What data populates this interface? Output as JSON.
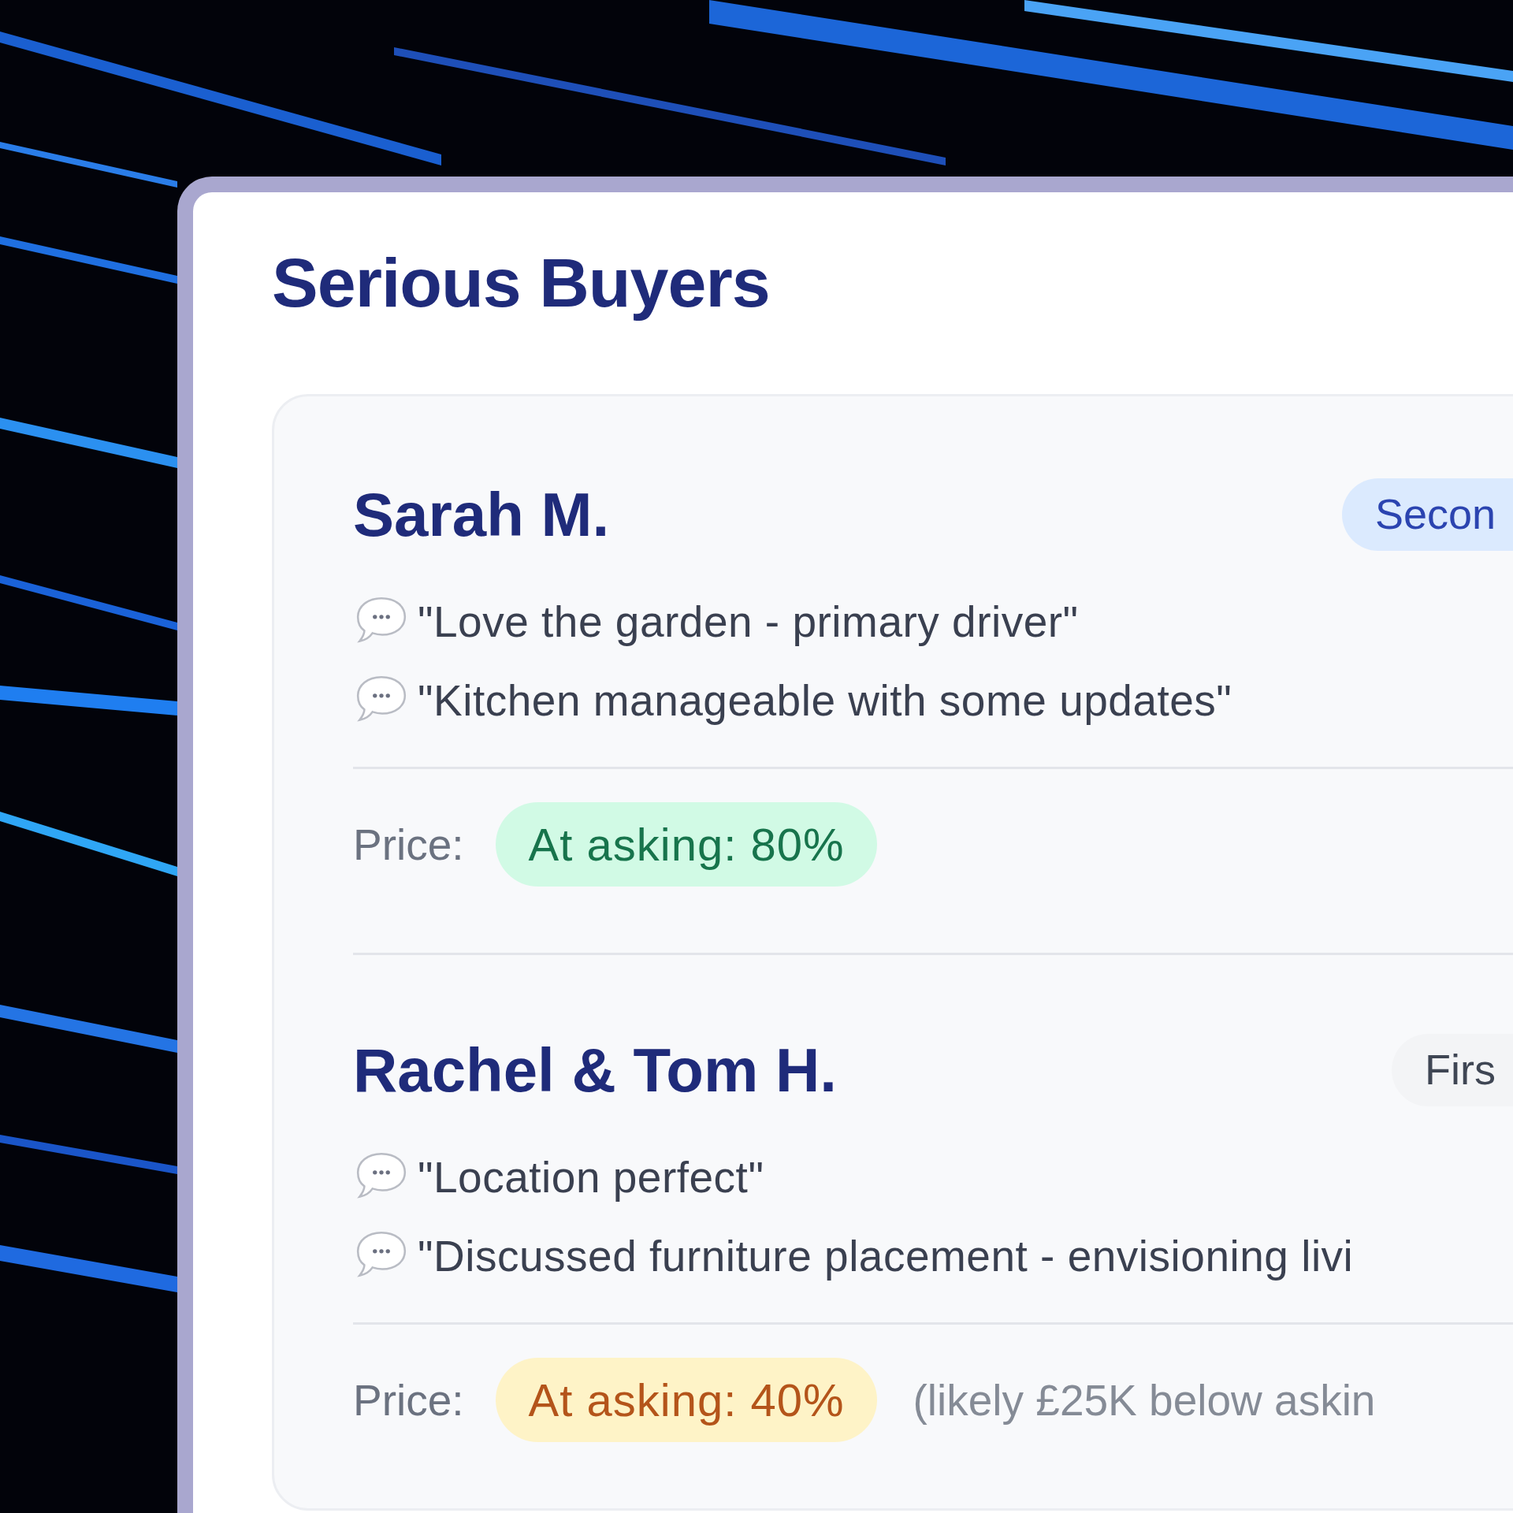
{
  "title": "Serious Buyers",
  "buyers": [
    {
      "name": "Sarah M.",
      "stage": {
        "label": "Secon",
        "color": "#dbeafe"
      },
      "comments": [
        "\"Love the garden - primary driver\"",
        "\"Kitchen manageable with some updates\""
      ],
      "price": {
        "label": "Price:",
        "value": "At asking: 80%",
        "color": "#d1fae5"
      }
    },
    {
      "name": "Rachel & Tom H.",
      "stage": {
        "label": "Firs",
        "color": "#f3f4f6"
      },
      "comments": [
        "\"Location perfect\"",
        "\"Discussed furniture placement - envisioning livi"
      ],
      "price": {
        "label": "Price:",
        "value": "At asking: 40%",
        "color": "#fef3c7",
        "note": "(likely £25K below askin"
      }
    }
  ]
}
